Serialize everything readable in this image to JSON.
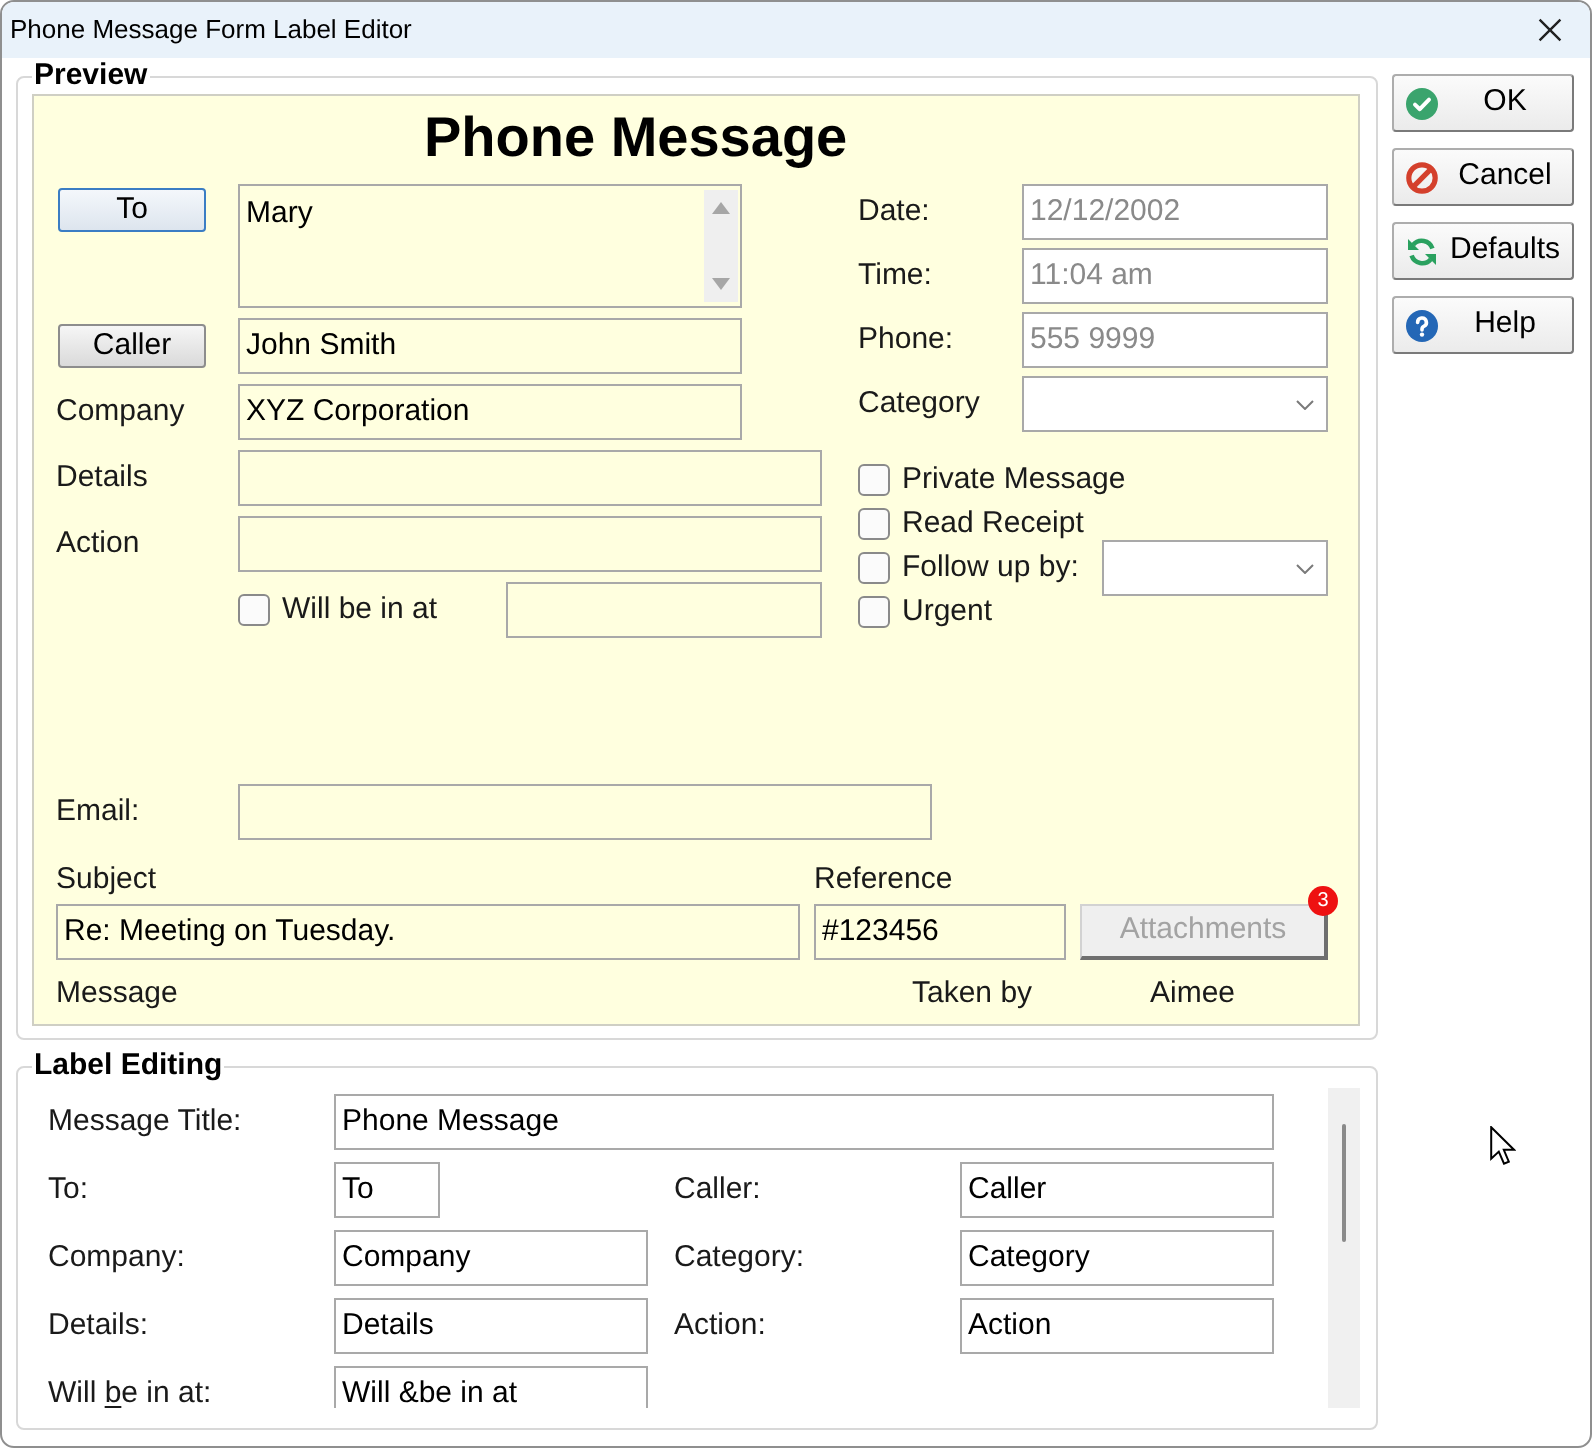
{
  "window": {
    "title": "Phone Message Form Label Editor"
  },
  "preview": {
    "caption": "Preview",
    "title": "Phone Message",
    "to": {
      "button": "To",
      "focused": true,
      "value": "Mary"
    },
    "caller": {
      "button": "Caller",
      "focused": false,
      "value": "John Smith"
    },
    "company": {
      "label": "Company",
      "value": "XYZ Corporation"
    },
    "details": {
      "label": "Details"
    },
    "action": {
      "label": "Action"
    },
    "will_be_in_at": {
      "label": "Will be in at",
      "checked": false
    },
    "date": {
      "label": "Date:",
      "value": "12/12/2002",
      "disabled": true
    },
    "time": {
      "label": "Time:",
      "value": "11:04 am",
      "disabled": true
    },
    "phone": {
      "label": "Phone:",
      "value": "555 9999",
      "disabled": true
    },
    "category": {
      "label": "Category"
    },
    "options": [
      {
        "label": "Private Message",
        "checked": false,
        "kind": "checkbox"
      },
      {
        "label": "Read Receipt",
        "checked": false,
        "kind": "checkbox"
      },
      {
        "label": "Follow up by:",
        "checked": false,
        "kind": "checkbox_dropdown"
      },
      {
        "label": "Urgent",
        "checked": false,
        "kind": "checkbox"
      }
    ],
    "email": {
      "label": "Email:"
    },
    "subject": {
      "label": "Subject",
      "value": "Re: Meeting on Tuesday."
    },
    "reference": {
      "label": "Reference",
      "value": "#123456"
    },
    "attachments": {
      "label": "Attachments",
      "disabled": true,
      "badge": "3"
    },
    "message": {
      "label": "Message"
    },
    "taken_by": {
      "label": "Taken by",
      "value": "Aimee"
    }
  },
  "buttons": [
    {
      "label": "OK",
      "kind": "ok"
    },
    {
      "label": "Cancel",
      "kind": "cancel"
    },
    {
      "label": "Defaults",
      "kind": "defaults"
    },
    {
      "label": "Help",
      "kind": "help"
    }
  ],
  "label_editing": {
    "caption": "Label Editing",
    "rows": [
      {
        "fields": [
          {
            "label": "Message Title:",
            "value": "Phone Message",
            "kind": "wide"
          }
        ]
      },
      {
        "fields": [
          {
            "label": "To:",
            "value": "To",
            "kind": "short"
          },
          {
            "label": "Caller:",
            "value": "Caller",
            "kind": "normal"
          }
        ]
      },
      {
        "fields": [
          {
            "label": "Company:",
            "value": "Company",
            "kind": "normal"
          },
          {
            "label": "Category:",
            "value": "Category",
            "kind": "normal"
          }
        ]
      },
      {
        "fields": [
          {
            "label": "Details:",
            "value": "Details",
            "kind": "normal"
          },
          {
            "label": "Action:",
            "value": "Action",
            "kind": "normal"
          }
        ]
      },
      {
        "fields": [
          {
            "label_parts": [
              {
                "text": "Will ",
                "underlined": false
              },
              {
                "text": "b",
                "underlined": true
              },
              {
                "text": "e in at:",
                "underlined": false
              }
            ],
            "value": "Will &be in at",
            "kind": "normal"
          }
        ]
      }
    ]
  }
}
